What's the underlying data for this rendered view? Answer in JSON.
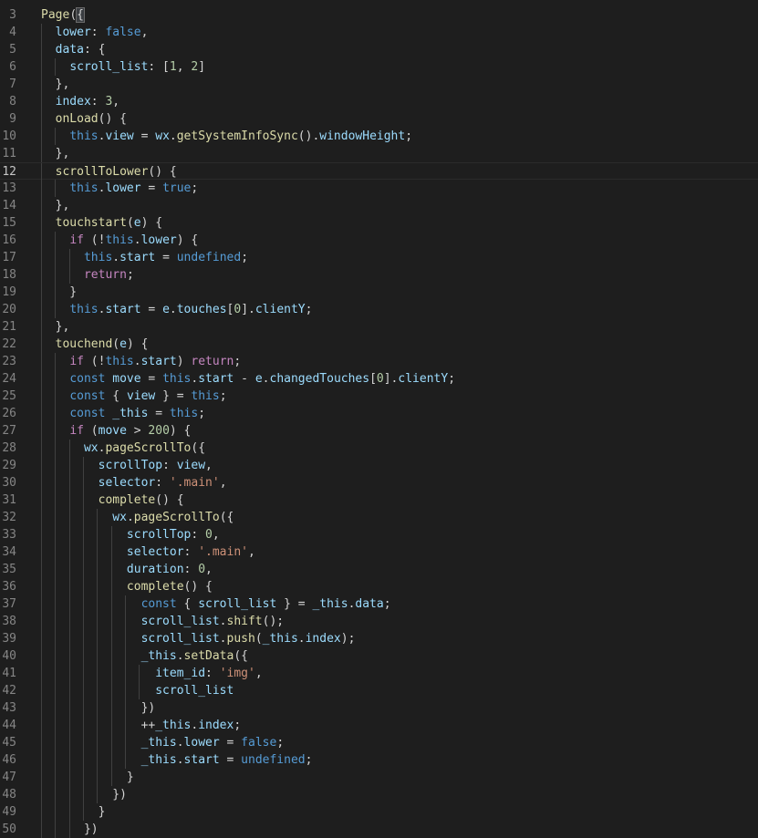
{
  "editor": {
    "active_line": 12,
    "lines": [
      {
        "num": "3",
        "tokens": [
          [
            "fn",
            "Page"
          ],
          [
            "p",
            "("
          ],
          [
            "hl",
            "{"
          ]
        ]
      },
      {
        "num": "4",
        "tokens": [
          [
            "p",
            "  "
          ],
          [
            "var",
            "lower"
          ],
          [
            "p",
            ": "
          ],
          [
            "kw",
            "false"
          ],
          [
            "p",
            ","
          ]
        ]
      },
      {
        "num": "5",
        "tokens": [
          [
            "p",
            "  "
          ],
          [
            "var",
            "data"
          ],
          [
            "p",
            ": {"
          ]
        ]
      },
      {
        "num": "6",
        "tokens": [
          [
            "p",
            "    "
          ],
          [
            "var",
            "scroll_list"
          ],
          [
            "p",
            ": ["
          ],
          [
            "num",
            "1"
          ],
          [
            "p",
            ", "
          ],
          [
            "num",
            "2"
          ],
          [
            "p",
            "]"
          ]
        ]
      },
      {
        "num": "7",
        "tokens": [
          [
            "p",
            "  },"
          ]
        ]
      },
      {
        "num": "8",
        "tokens": [
          [
            "p",
            "  "
          ],
          [
            "var",
            "index"
          ],
          [
            "p",
            ": "
          ],
          [
            "num",
            "3"
          ],
          [
            "p",
            ","
          ]
        ]
      },
      {
        "num": "9",
        "tokens": [
          [
            "p",
            "  "
          ],
          [
            "fn",
            "onLoad"
          ],
          [
            "p",
            "() {"
          ]
        ]
      },
      {
        "num": "10",
        "tokens": [
          [
            "p",
            "    "
          ],
          [
            "kw",
            "this"
          ],
          [
            "p",
            "."
          ],
          [
            "var",
            "view"
          ],
          [
            "p",
            " = "
          ],
          [
            "var",
            "wx"
          ],
          [
            "p",
            "."
          ],
          [
            "fn",
            "getSystemInfoSync"
          ],
          [
            "p",
            "()."
          ],
          [
            "var",
            "windowHeight"
          ],
          [
            "p",
            ";"
          ]
        ]
      },
      {
        "num": "11",
        "tokens": [
          [
            "p",
            "  },"
          ]
        ]
      },
      {
        "num": "12",
        "tokens": [
          [
            "p",
            "  "
          ],
          [
            "fn",
            "scrollToLower"
          ],
          [
            "p",
            "() {"
          ]
        ]
      },
      {
        "num": "13",
        "tokens": [
          [
            "p",
            "    "
          ],
          [
            "kw",
            "this"
          ],
          [
            "p",
            "."
          ],
          [
            "var",
            "lower"
          ],
          [
            "p",
            " = "
          ],
          [
            "kw",
            "true"
          ],
          [
            "p",
            ";"
          ]
        ]
      },
      {
        "num": "14",
        "tokens": [
          [
            "p",
            "  },"
          ]
        ]
      },
      {
        "num": "15",
        "tokens": [
          [
            "p",
            "  "
          ],
          [
            "fn",
            "touchstart"
          ],
          [
            "p",
            "("
          ],
          [
            "var",
            "e"
          ],
          [
            "p",
            ") {"
          ]
        ]
      },
      {
        "num": "16",
        "tokens": [
          [
            "p",
            "    "
          ],
          [
            "ctrl",
            "if"
          ],
          [
            "p",
            " (!"
          ],
          [
            "kw",
            "this"
          ],
          [
            "p",
            "."
          ],
          [
            "var",
            "lower"
          ],
          [
            "p",
            ") {"
          ]
        ]
      },
      {
        "num": "17",
        "tokens": [
          [
            "p",
            "      "
          ],
          [
            "kw",
            "this"
          ],
          [
            "p",
            "."
          ],
          [
            "var",
            "start"
          ],
          [
            "p",
            " = "
          ],
          [
            "kw",
            "undefined"
          ],
          [
            "p",
            ";"
          ]
        ]
      },
      {
        "num": "18",
        "tokens": [
          [
            "p",
            "      "
          ],
          [
            "ctrl",
            "return"
          ],
          [
            "p",
            ";"
          ]
        ]
      },
      {
        "num": "19",
        "tokens": [
          [
            "p",
            "    }"
          ]
        ]
      },
      {
        "num": "20",
        "tokens": [
          [
            "p",
            "    "
          ],
          [
            "kw",
            "this"
          ],
          [
            "p",
            "."
          ],
          [
            "var",
            "start"
          ],
          [
            "p",
            " = "
          ],
          [
            "var",
            "e"
          ],
          [
            "p",
            "."
          ],
          [
            "var",
            "touches"
          ],
          [
            "p",
            "["
          ],
          [
            "num",
            "0"
          ],
          [
            "p",
            "]."
          ],
          [
            "var",
            "clientY"
          ],
          [
            "p",
            ";"
          ]
        ]
      },
      {
        "num": "21",
        "tokens": [
          [
            "p",
            "  },"
          ]
        ]
      },
      {
        "num": "22",
        "tokens": [
          [
            "p",
            "  "
          ],
          [
            "fn",
            "touchend"
          ],
          [
            "p",
            "("
          ],
          [
            "var",
            "e"
          ],
          [
            "p",
            ") {"
          ]
        ]
      },
      {
        "num": "23",
        "tokens": [
          [
            "p",
            "    "
          ],
          [
            "ctrl",
            "if"
          ],
          [
            "p",
            " (!"
          ],
          [
            "kw",
            "this"
          ],
          [
            "p",
            "."
          ],
          [
            "var",
            "start"
          ],
          [
            "p",
            ") "
          ],
          [
            "ctrl",
            "return"
          ],
          [
            "p",
            ";"
          ]
        ]
      },
      {
        "num": "24",
        "tokens": [
          [
            "p",
            "    "
          ],
          [
            "kw",
            "const"
          ],
          [
            "p",
            " "
          ],
          [
            "var",
            "move"
          ],
          [
            "p",
            " = "
          ],
          [
            "kw",
            "this"
          ],
          [
            "p",
            "."
          ],
          [
            "var",
            "start"
          ],
          [
            "p",
            " - "
          ],
          [
            "var",
            "e"
          ],
          [
            "p",
            "."
          ],
          [
            "var",
            "changedTouches"
          ],
          [
            "p",
            "["
          ],
          [
            "num",
            "0"
          ],
          [
            "p",
            "]."
          ],
          [
            "var",
            "clientY"
          ],
          [
            "p",
            ";"
          ]
        ]
      },
      {
        "num": "25",
        "tokens": [
          [
            "p",
            "    "
          ],
          [
            "kw",
            "const"
          ],
          [
            "p",
            " { "
          ],
          [
            "var",
            "view"
          ],
          [
            "p",
            " } = "
          ],
          [
            "kw",
            "this"
          ],
          [
            "p",
            ";"
          ]
        ]
      },
      {
        "num": "26",
        "tokens": [
          [
            "p",
            "    "
          ],
          [
            "kw",
            "const"
          ],
          [
            "p",
            " "
          ],
          [
            "var",
            "_this"
          ],
          [
            "p",
            " = "
          ],
          [
            "kw",
            "this"
          ],
          [
            "p",
            ";"
          ]
        ]
      },
      {
        "num": "27",
        "tokens": [
          [
            "p",
            "    "
          ],
          [
            "ctrl",
            "if"
          ],
          [
            "p",
            " ("
          ],
          [
            "var",
            "move"
          ],
          [
            "p",
            " > "
          ],
          [
            "num",
            "200"
          ],
          [
            "p",
            ") {"
          ]
        ]
      },
      {
        "num": "28",
        "tokens": [
          [
            "p",
            "      "
          ],
          [
            "var",
            "wx"
          ],
          [
            "p",
            "."
          ],
          [
            "fn",
            "pageScrollTo"
          ],
          [
            "p",
            "({"
          ]
        ]
      },
      {
        "num": "29",
        "tokens": [
          [
            "p",
            "        "
          ],
          [
            "var",
            "scrollTop"
          ],
          [
            "p",
            ": "
          ],
          [
            "var",
            "view"
          ],
          [
            "p",
            ","
          ]
        ]
      },
      {
        "num": "30",
        "tokens": [
          [
            "p",
            "        "
          ],
          [
            "var",
            "selector"
          ],
          [
            "p",
            ": "
          ],
          [
            "str",
            "'.main'"
          ],
          [
            "p",
            ","
          ]
        ]
      },
      {
        "num": "31",
        "tokens": [
          [
            "p",
            "        "
          ],
          [
            "fn",
            "complete"
          ],
          [
            "p",
            "() {"
          ]
        ]
      },
      {
        "num": "32",
        "tokens": [
          [
            "p",
            "          "
          ],
          [
            "var",
            "wx"
          ],
          [
            "p",
            "."
          ],
          [
            "fn",
            "pageScrollTo"
          ],
          [
            "p",
            "({"
          ]
        ]
      },
      {
        "num": "33",
        "tokens": [
          [
            "p",
            "            "
          ],
          [
            "var",
            "scrollTop"
          ],
          [
            "p",
            ": "
          ],
          [
            "num",
            "0"
          ],
          [
            "p",
            ","
          ]
        ]
      },
      {
        "num": "34",
        "tokens": [
          [
            "p",
            "            "
          ],
          [
            "var",
            "selector"
          ],
          [
            "p",
            ": "
          ],
          [
            "str",
            "'.main'"
          ],
          [
            "p",
            ","
          ]
        ]
      },
      {
        "num": "35",
        "tokens": [
          [
            "p",
            "            "
          ],
          [
            "var",
            "duration"
          ],
          [
            "p",
            ": "
          ],
          [
            "num",
            "0"
          ],
          [
            "p",
            ","
          ]
        ]
      },
      {
        "num": "36",
        "tokens": [
          [
            "p",
            "            "
          ],
          [
            "fn",
            "complete"
          ],
          [
            "p",
            "() {"
          ]
        ]
      },
      {
        "num": "37",
        "tokens": [
          [
            "p",
            "              "
          ],
          [
            "kw",
            "const"
          ],
          [
            "p",
            " { "
          ],
          [
            "var",
            "scroll_list"
          ],
          [
            "p",
            " } = "
          ],
          [
            "var",
            "_this"
          ],
          [
            "p",
            "."
          ],
          [
            "var",
            "data"
          ],
          [
            "p",
            ";"
          ]
        ]
      },
      {
        "num": "38",
        "tokens": [
          [
            "p",
            "              "
          ],
          [
            "var",
            "scroll_list"
          ],
          [
            "p",
            "."
          ],
          [
            "fn",
            "shift"
          ],
          [
            "p",
            "();"
          ]
        ]
      },
      {
        "num": "39",
        "tokens": [
          [
            "p",
            "              "
          ],
          [
            "var",
            "scroll_list"
          ],
          [
            "p",
            "."
          ],
          [
            "fn",
            "push"
          ],
          [
            "p",
            "("
          ],
          [
            "var",
            "_this"
          ],
          [
            "p",
            "."
          ],
          [
            "var",
            "index"
          ],
          [
            "p",
            ");"
          ]
        ]
      },
      {
        "num": "40",
        "tokens": [
          [
            "p",
            "              "
          ],
          [
            "var",
            "_this"
          ],
          [
            "p",
            "."
          ],
          [
            "fn",
            "setData"
          ],
          [
            "p",
            "({"
          ]
        ]
      },
      {
        "num": "41",
        "tokens": [
          [
            "p",
            "                "
          ],
          [
            "var",
            "item_id"
          ],
          [
            "p",
            ": "
          ],
          [
            "str",
            "'img'"
          ],
          [
            "p",
            ","
          ]
        ]
      },
      {
        "num": "42",
        "tokens": [
          [
            "p",
            "                "
          ],
          [
            "var",
            "scroll_list"
          ]
        ]
      },
      {
        "num": "43",
        "tokens": [
          [
            "p",
            "              })"
          ]
        ]
      },
      {
        "num": "44",
        "tokens": [
          [
            "p",
            "              ++"
          ],
          [
            "var",
            "_this"
          ],
          [
            "p",
            "."
          ],
          [
            "var",
            "index"
          ],
          [
            "p",
            ";"
          ]
        ]
      },
      {
        "num": "45",
        "tokens": [
          [
            "p",
            "              "
          ],
          [
            "var",
            "_this"
          ],
          [
            "p",
            "."
          ],
          [
            "var",
            "lower"
          ],
          [
            "p",
            " = "
          ],
          [
            "kw",
            "false"
          ],
          [
            "p",
            ";"
          ]
        ]
      },
      {
        "num": "46",
        "tokens": [
          [
            "p",
            "              "
          ],
          [
            "var",
            "_this"
          ],
          [
            "p",
            "."
          ],
          [
            "var",
            "start"
          ],
          [
            "p",
            " = "
          ],
          [
            "kw",
            "undefined"
          ],
          [
            "p",
            ";"
          ]
        ]
      },
      {
        "num": "47",
        "tokens": [
          [
            "p",
            "            }"
          ]
        ]
      },
      {
        "num": "48",
        "tokens": [
          [
            "p",
            "          })"
          ]
        ]
      },
      {
        "num": "49",
        "tokens": [
          [
            "p",
            "        }"
          ]
        ]
      },
      {
        "num": "50",
        "tokens": [
          [
            "p",
            "      })"
          ]
        ]
      }
    ]
  }
}
